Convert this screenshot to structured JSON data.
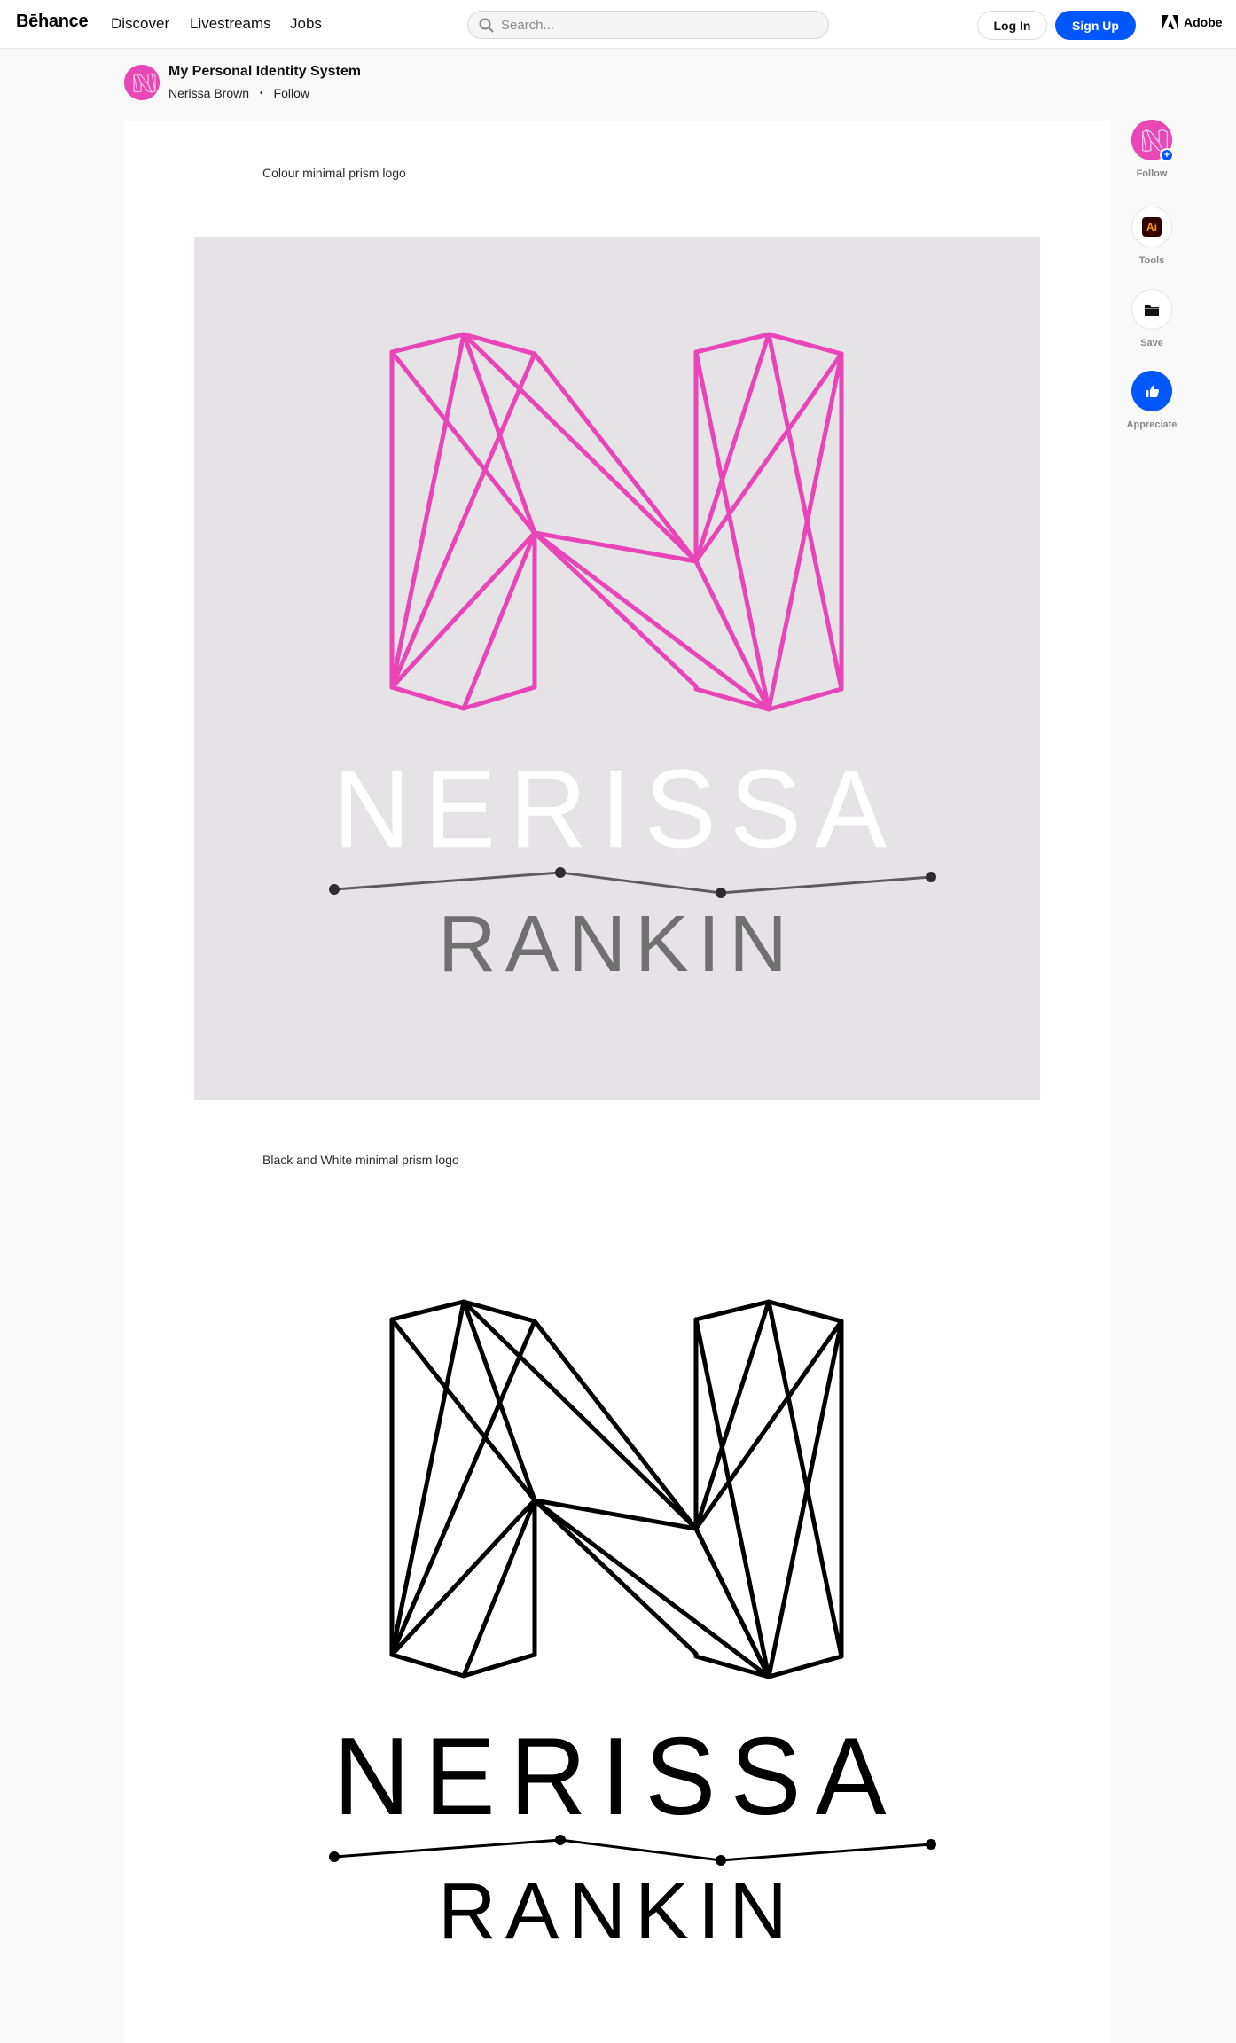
{
  "nav": {
    "brand": "Bēhance",
    "links": [
      "Discover",
      "Livestreams",
      "Jobs"
    ],
    "search_placeholder": "Search...",
    "login_label": "Log In",
    "signup_label": "Sign Up",
    "adobe_label": "Adobe"
  },
  "project": {
    "title": "My Personal Identity System",
    "author": "Nerissa Brown",
    "follow_label": "Follow",
    "separator": "•"
  },
  "content": {
    "blocks": [
      {
        "caption": "Colour minimal prism logo",
        "logo_top": "NERISSA",
        "logo_bottom": "RANKIN",
        "colors": {
          "background": "#e5e3e6",
          "monogram": "#e845b6",
          "top_text": "#ffffff",
          "line": "#5e5c5f",
          "bottom_text": "#717071"
        }
      },
      {
        "caption": "Black and White minimal prism logo",
        "logo_top": "NERISSA",
        "logo_bottom": "RANKIN",
        "colors": {
          "background": "#ffffff",
          "monogram": "#000000",
          "top_text": "#000000",
          "line": "#000000",
          "bottom_text": "#000000"
        }
      }
    ]
  },
  "rail": {
    "follow_label": "Follow",
    "tools_label": "Tools",
    "tools_badge": "Ai",
    "save_label": "Save",
    "appreciate_label": "Appreciate"
  },
  "icons": [
    "search-icon",
    "adobe-logo-icon",
    "avatar-monogram-icon",
    "plus-icon",
    "illustrator-icon",
    "folder-icon",
    "thumbs-up-icon"
  ],
  "colors": {
    "accent": "#0057ff",
    "brand_pink": "#e848b6"
  }
}
